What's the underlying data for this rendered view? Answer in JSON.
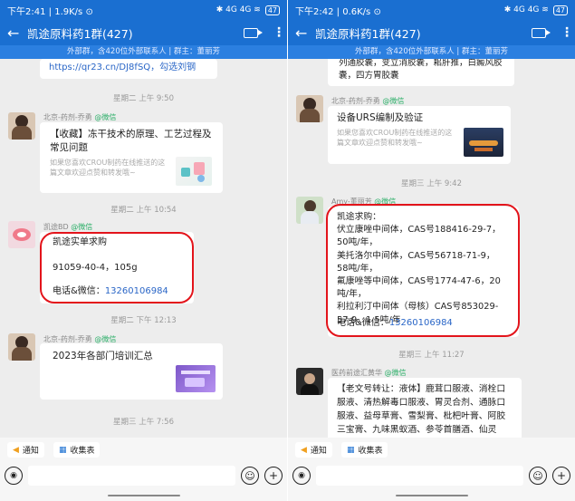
{
  "left": {
    "status": {
      "time": "下午2:41",
      "speed": "1.9K/s",
      "extra": "⊙",
      "signal": "✱ 4G 4G ≋",
      "battery": "47"
    },
    "header": {
      "back": "←",
      "title": "凯途原料药1群(427)",
      "sub": "外部群，含420位外部联系人 | 群主：董丽芳",
      "more": "⋮"
    },
    "messages": {
      "top_text": "https://qr23.cn/DJ8fSQ，勾选刘钢",
      "ts1": "星期二 上午 9:50",
      "m1_sender": "北京-药剂-乔勇",
      "m1_wx": "@微信",
      "m1_title": "【收藏】冻干技术的原理、工艺过程及常见问题",
      "m1_desc": "如果您喜欢CROU制药在线推送的这篇文章欢迎点赞和转发哦~",
      "ts2": "星期二 上午 10:54",
      "m2_sender": "凯途BD",
      "m2_wx": "@微信",
      "m2_line1": "凯途实单求购",
      "m2_line2": "91059-40-4，105g",
      "m2_phone_label": "电话&微信：",
      "m2_phone": "13260106984",
      "ts3": "星期二 下午 12:13",
      "m3_sender": "北京-药剂-乔勇",
      "m3_wx": "@微信",
      "m3_title": "2023年各部门培训汇总",
      "ts4": "星期三 上午 7:56"
    },
    "quick": {
      "notice": "通知",
      "form": "收集表"
    }
  },
  "right": {
    "status": {
      "time": "下午2:42",
      "speed": "0.6K/s",
      "extra": "⊙",
      "signal": "✱ 4G 4G ≋",
      "battery": "47"
    },
    "header": {
      "back": "←",
      "title": "凯途原料药1群(427)",
      "sub": "外部群，含420位外部联系人 | 群主：董丽芳",
      "more": "⋮"
    },
    "messages": {
      "top_text": "列通胶囊，变立消胶囊，耜肝推，白癜风胶囊，四方胃胶囊",
      "m1_sender": "北京-药剂-乔勇",
      "m1_wx": "@微信",
      "m1_title": "设备URS编制及验证",
      "m1_desc": "如果您喜欢CROU制药在线推送的这篇文章欢迎点赞和转发哦~",
      "ts1": "星期三 上午 9:42",
      "m2_sender": "Amy-董丽芳",
      "m2_wx": "@微信",
      "m2_body": "凯途求购：\n伏立康唑中间体，CAS号188416-29-7，50吨/年，\n美托洛尔中间体，CAS号56718-71-9，58吨/年，\n氟康唑等中间体，CAS号1774-47-6，20吨/年，\n利拉利汀中间体（母核）CAS号853029-57-9，1.5吨/年",
      "m2_phone_label": "电话&微信：",
      "m2_phone": "13260106984",
      "ts2": "星期三 上午 11:27",
      "m3_sender": "医药前途汇黄华",
      "m3_wx": "@微信",
      "m3_body": "【老文号转让：液体】鹿茸口服液、消栓口服液、清热解毒口服液、胃灵合剂、通脉口服液、益母草膏、雪梨膏、枇杷叶膏、阿胶三宝膏、九味黑蚁酒、参苓首膳酒、仙灵酒、中阳骨药酒、参杞酒"
    },
    "quick": {
      "notice": "通知",
      "form": "收集表"
    }
  }
}
